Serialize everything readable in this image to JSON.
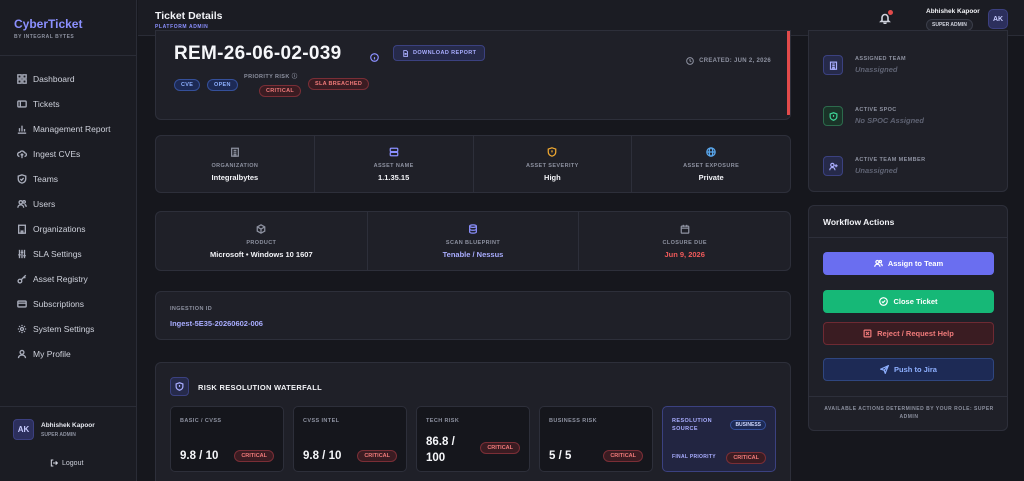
{
  "brand": {
    "title": "CyberTicket",
    "subtitle": "BY INTEGRAL BYTES"
  },
  "sidebar": {
    "items": [
      {
        "label": "Dashboard",
        "icon": "dashboard-icon"
      },
      {
        "label": "Tickets",
        "icon": "ticket-icon"
      },
      {
        "label": "Management Report",
        "icon": "chart-icon"
      },
      {
        "label": "Ingest CVEs",
        "icon": "cloud-upload-icon"
      },
      {
        "label": "Teams",
        "icon": "shield-icon"
      },
      {
        "label": "Users",
        "icon": "users-icon"
      },
      {
        "label": "Organizations",
        "icon": "building-icon"
      },
      {
        "label": "SLA Settings",
        "icon": "sliders-icon"
      },
      {
        "label": "Asset Registry",
        "icon": "key-icon"
      },
      {
        "label": "Subscriptions",
        "icon": "card-icon"
      },
      {
        "label": "System Settings",
        "icon": "gear-icon"
      },
      {
        "label": "My Profile",
        "icon": "user-icon"
      }
    ],
    "user": {
      "initials": "AK",
      "name": "Abhishek Kapoor",
      "role": "SUPER ADMIN"
    },
    "logout": "Logout"
  },
  "header": {
    "title": "Ticket Details",
    "subtitle": "PLATFORM ADMIN",
    "user": {
      "name": "Abhishek Kapoor",
      "role": "SUPER ADMIN",
      "initials": "AK"
    }
  },
  "ticket": {
    "id": "REM-26-06-02-039",
    "download_label": "DOWNLOAD REPORT",
    "created": "CREATED: JUN 2, 2026",
    "tags": [
      "CVE",
      "OPEN"
    ],
    "priority_label": "PRIORITY RISK",
    "priority_value": "CRITICAL",
    "sla_status": "SLA BREACHED"
  },
  "asset_meta": [
    {
      "label": "ORGANIZATION",
      "value": "Integralbytes",
      "icon": "building-icon"
    },
    {
      "label": "ASSET NAME",
      "value": "1.1.35.15",
      "icon": "server-icon"
    },
    {
      "label": "ASSET SEVERITY",
      "value": "High",
      "icon": "shield-alert-icon"
    },
    {
      "label": "ASSET EXPOSURE",
      "value": "Private",
      "icon": "globe-icon"
    }
  ],
  "product_meta": [
    {
      "label": "PRODUCT",
      "value": "Microsoft • Windows 10 1607",
      "icon": "cube-icon"
    },
    {
      "label": "SCAN BLUEPRINT",
      "value": "Tenable / Nessus",
      "icon": "database-icon"
    },
    {
      "label": "CLOSURE DUE",
      "value": "Jun 9, 2026",
      "icon": "calendar-icon"
    }
  ],
  "ingestion": {
    "label": "INGESTION ID",
    "value": "Ingest-5E35-20260602-006"
  },
  "waterfall": {
    "title": "RISK RESOLUTION WATERFALL",
    "steps": [
      {
        "label": "BASIC / CVSS",
        "value": "9.8 / 10",
        "badge": "CRITICAL"
      },
      {
        "label": "CVSS INTEL",
        "value": "9.8 / 10",
        "badge": "CRITICAL"
      },
      {
        "label": "TECH RISK",
        "value": "86.8 / 100",
        "badge": "CRITICAL"
      },
      {
        "label": "BUSINESS RISK",
        "value": "5 / 5",
        "badge": "CRITICAL"
      }
    ],
    "resolution": {
      "label": "RESOLUTION SOURCE",
      "source": "BUSINESS",
      "final_label": "FINAL PRIORITY",
      "final_value": "CRITICAL"
    }
  },
  "assignment": [
    {
      "label": "ASSIGNED TEAM",
      "value": "Unassigned",
      "icon": "building-icon"
    },
    {
      "label": "ACTIVE SPOC",
      "value": "No SPOC Assigned",
      "icon": "shield-icon"
    },
    {
      "label": "ACTIVE TEAM MEMBER",
      "value": "Unassigned",
      "icon": "user-plus-icon"
    }
  ],
  "workflow": {
    "title": "Workflow Actions",
    "actions": {
      "assign": "Assign to Team",
      "close": "Close Ticket",
      "reject": "Reject / Request Help",
      "jira": "Push to Jira"
    },
    "note": "AVAILABLE ACTIONS DETERMINED BY YOUR ROLE: SUPER ADMIN"
  },
  "colors": {
    "accent": "#6a6ef0",
    "critical": "#e24b4b",
    "success": "#16b877",
    "background": "#16171d"
  }
}
